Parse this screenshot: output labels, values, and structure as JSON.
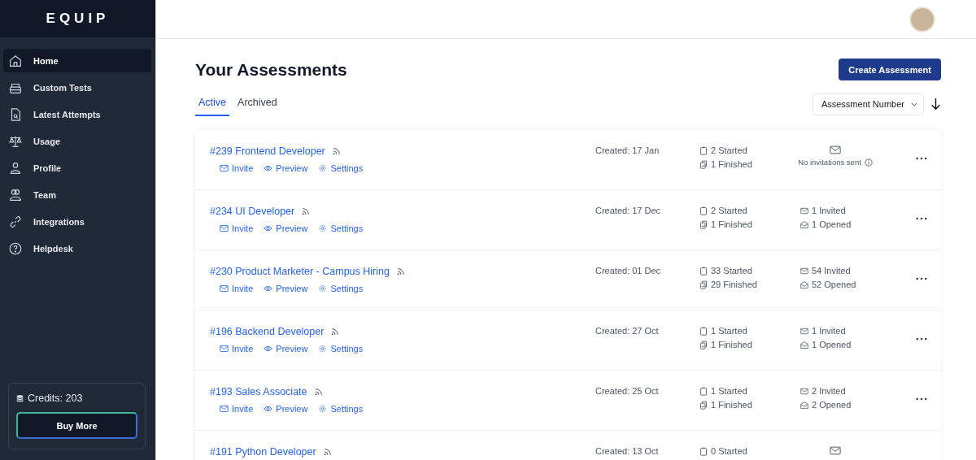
{
  "sidebar": {
    "logo": "EQUIP",
    "items": [
      {
        "label": "Home",
        "selected": true
      },
      {
        "label": "Custom Tests",
        "selected": false
      },
      {
        "label": "Latest Attempts",
        "selected": false
      },
      {
        "label": "Usage",
        "selected": false
      },
      {
        "label": "Profile",
        "selected": false
      },
      {
        "label": "Team",
        "selected": false
      },
      {
        "label": "Integrations",
        "selected": false
      },
      {
        "label": "Helpdesk",
        "selected": false
      }
    ],
    "credits": {
      "label": "Credits: 203",
      "button": "Buy More"
    }
  },
  "page": {
    "title": "Your Assessments",
    "create_button": "Create Assessment",
    "tabs": [
      {
        "label": "Active",
        "selected": true
      },
      {
        "label": "Archived",
        "selected": false
      }
    ],
    "sort": {
      "value": "Assessment Number"
    }
  },
  "assessments": [
    {
      "title": "#239 Frontend Developer",
      "actions": [
        "Invite",
        "Preview",
        "Settings"
      ],
      "created": "Created: 17 Jan",
      "started": "2 Started",
      "finished": "1 Finished",
      "invites": {
        "kind": "none",
        "text": "No invitations sent"
      }
    },
    {
      "title": "#234 UI Developer",
      "actions": [
        "Invite",
        "Preview",
        "Settings"
      ],
      "created": "Created: 17 Dec",
      "started": "2 Started",
      "finished": "1 Finished",
      "invites": {
        "kind": "counts",
        "invited": "1 Invited",
        "opened": "1 Opened"
      }
    },
    {
      "title": "#230 Product Marketer - Campus Hiring",
      "actions": [
        "Invite",
        "Preview",
        "Settings"
      ],
      "created": "Created: 01 Dec",
      "started": "33 Started",
      "finished": "29 Finished",
      "invites": {
        "kind": "counts",
        "invited": "54 Invited",
        "opened": "52 Opened"
      }
    },
    {
      "title": "#196 Backend Developer",
      "actions": [
        "Invite",
        "Preview",
        "Settings"
      ],
      "created": "Created: 27 Oct",
      "started": "1 Started",
      "finished": "1 Finished",
      "invites": {
        "kind": "counts",
        "invited": "1 Invited",
        "opened": "1 Opened"
      }
    },
    {
      "title": "#193 Sales Associate",
      "actions": [
        "Invite",
        "Preview",
        "Settings"
      ],
      "created": "Created: 25 Oct",
      "started": "1 Started",
      "finished": "1 Finished",
      "invites": {
        "kind": "counts",
        "invited": "2 Invited",
        "opened": "2 Opened"
      }
    },
    {
      "title": "#191 Python Developer",
      "created": "Created: 13 Oct",
      "started": "0 Started",
      "invites": {
        "kind": "none"
      }
    }
  ]
}
